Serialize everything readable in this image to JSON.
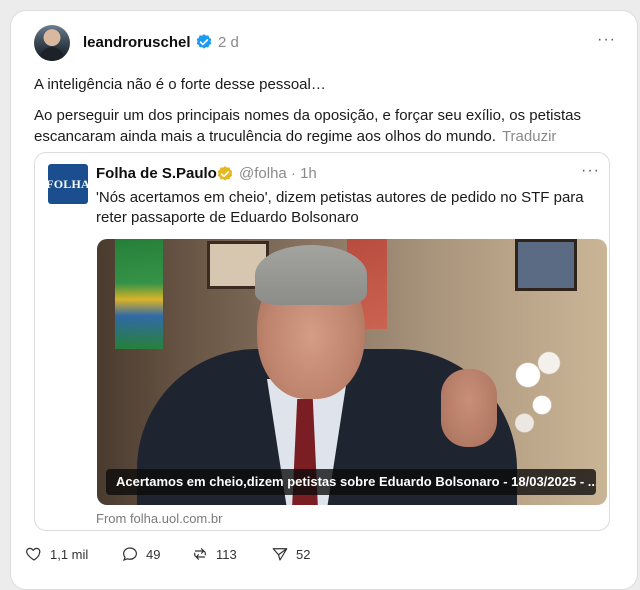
{
  "post": {
    "username": "leandroruschel",
    "time": "2 d",
    "more": "···",
    "text1": "A inteligência não é o forte desse pessoal…",
    "text2": "Ao perseguir um dos principais nomes da oposição, e forçar seu exílio, os petistas escancaram ainda mais a truculência do regime aos olhos do mundo.",
    "translate": "Traduzir"
  },
  "embed": {
    "logo_text": "FOLHA",
    "name": "Folha de S.Paulo",
    "handle": "@folha · 1h",
    "more": "···",
    "title": "'Nós acertamos em cheio', dizem petistas autores de pedido no STF para reter passaporte de Eduardo Bolsonaro",
    "image_caption": "Acertamos em cheio,dizem petistas sobre Eduardo Bolsonaro - 18/03/2025 - ...",
    "source": "From folha.uol.com.br"
  },
  "actions": {
    "likes": "1,1 mil",
    "replies": "49",
    "reposts": "113",
    "shares": "52"
  },
  "colors": {
    "verified_blue": "#1d9bf0",
    "gold": "#e5b820",
    "folha_blue": "#1a4e8f"
  }
}
